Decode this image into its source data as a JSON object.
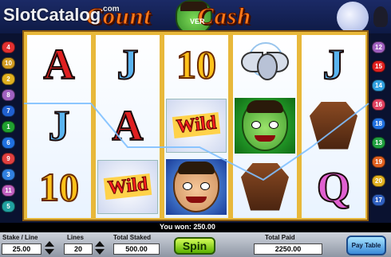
{
  "watermark": {
    "text": "SlotCatalog",
    "suffix": ".com"
  },
  "title": {
    "left": "Count",
    "middle": "VER",
    "right": "Cash"
  },
  "reels": [
    [
      {
        "type": "letter",
        "text": "A",
        "color": "red"
      },
      {
        "type": "letter",
        "text": "J",
        "color": "blue"
      },
      {
        "type": "ten",
        "text": "10"
      }
    ],
    [
      {
        "type": "letter",
        "text": "J",
        "color": "blue"
      },
      {
        "type": "letter",
        "text": "A",
        "color": "red"
      },
      {
        "type": "wild",
        "text": "Wild"
      }
    ],
    [
      {
        "type": "ten",
        "text": "10"
      },
      {
        "type": "wild",
        "text": "Wild"
      },
      {
        "type": "face-tan",
        "text": ""
      }
    ],
    [
      {
        "type": "bat",
        "text": ""
      },
      {
        "type": "face-green",
        "text": ""
      },
      {
        "type": "coffin",
        "text": ""
      }
    ],
    [
      {
        "type": "letter",
        "text": "J",
        "color": "blue"
      },
      {
        "type": "coffin",
        "text": ""
      },
      {
        "type": "letter",
        "text": "Q",
        "color": "purple"
      }
    ]
  ],
  "paylines_left": [
    {
      "num": "4",
      "color": "#e23030"
    },
    {
      "num": "10",
      "color": "#d09a20"
    },
    {
      "num": "2",
      "color": "#e0b020"
    },
    {
      "num": "8",
      "color": "#a060c0"
    },
    {
      "num": "7",
      "color": "#2060d0"
    },
    {
      "num": "1",
      "color": "#20a030"
    },
    {
      "num": "6",
      "color": "#2070e0"
    },
    {
      "num": "9",
      "color": "#e04040"
    },
    {
      "num": "3",
      "color": "#3080e0"
    },
    {
      "num": "11",
      "color": "#c060c0"
    },
    {
      "num": "5",
      "color": "#20a0a0"
    }
  ],
  "paylines_right": [
    {
      "num": "12",
      "color": "#a060c0"
    },
    {
      "num": "15",
      "color": "#e02020"
    },
    {
      "num": "14",
      "color": "#30a0e0"
    },
    {
      "num": "16",
      "color": "#e04060"
    },
    {
      "num": "18",
      "color": "#2070e0"
    },
    {
      "num": "13",
      "color": "#20a040"
    },
    {
      "num": "19",
      "color": "#e06020"
    },
    {
      "num": "20",
      "color": "#e0b020"
    },
    {
      "num": "17",
      "color": "#3060c0"
    }
  ],
  "win_message": "You won: 250.00",
  "controls": {
    "stake_label": "Stake / Line",
    "stake_value": "25.00",
    "lines_label": "Lines",
    "lines_value": "20",
    "total_staked_label": "Total Staked",
    "total_staked_value": "500.00",
    "spin_label": "Spin",
    "total_paid_label": "Total Paid",
    "total_paid_value": "2250.00",
    "paytable_label": "Pay Table"
  }
}
